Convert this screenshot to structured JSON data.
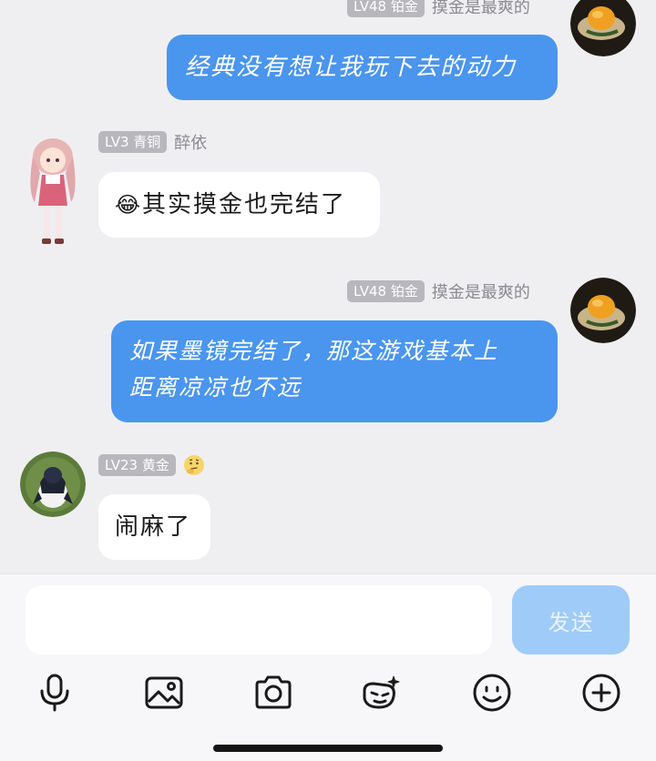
{
  "messages": [
    {
      "side": "out",
      "level": "LV48 铂金",
      "nickname": "摸金是最爽的",
      "text": "经典没有想让我玩下去的动力"
    },
    {
      "side": "in",
      "level": "LV3 青铜",
      "nickname": "醉依",
      "text": "其实摸金也完结了",
      "emoji": "😂"
    },
    {
      "side": "out",
      "level": "LV48 铂金",
      "nickname": "摸金是最爽的",
      "text_line1": "如果墨镜完结了，那这游戏基本上",
      "text_line2": "距离凉凉也不远"
    },
    {
      "side": "in",
      "level": "LV23 黄金",
      "nickname_icon": "thinking-face-emoji",
      "text": "闹麻了"
    }
  ],
  "composer": {
    "placeholder": "",
    "send_label": "发送"
  },
  "toolbar": [
    "microphone-icon",
    "image-icon",
    "camera-icon",
    "sticker-icon",
    "emoji-icon",
    "plus-icon"
  ],
  "colors": {
    "outgoing_bubble": "#4a95ee",
    "incoming_bubble": "#ffffff",
    "background": "#efeff2",
    "send_button_disabled": "#9ecbf7"
  }
}
